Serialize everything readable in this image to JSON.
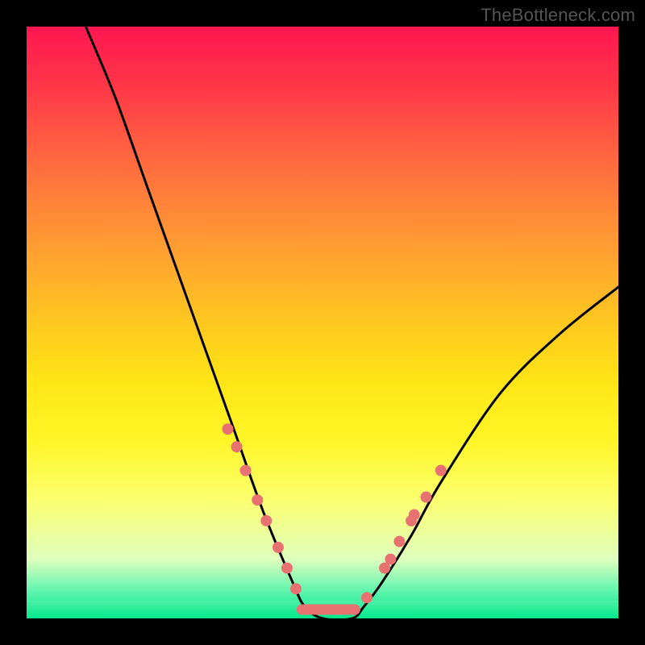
{
  "watermark": "TheBottleneck.com",
  "chart_data": {
    "type": "line",
    "title": "",
    "xlabel": "",
    "ylabel": "",
    "xlim": [
      0,
      100
    ],
    "ylim": [
      0,
      100
    ],
    "series": [
      {
        "name": "bottleneck-curve",
        "x": [
          10,
          15,
          20,
          25,
          30,
          35,
          40,
          45,
          47,
          50,
          55,
          57,
          60,
          65,
          70,
          80,
          90,
          100
        ],
        "y": [
          100,
          88,
          74,
          60,
          46,
          32,
          18,
          6,
          2,
          0,
          0,
          2,
          6,
          14,
          23,
          38,
          48,
          56
        ]
      }
    ],
    "markers_left": [
      {
        "x": 34.0,
        "y": 32.0
      },
      {
        "x": 35.5,
        "y": 29.0
      },
      {
        "x": 37.0,
        "y": 25.0
      },
      {
        "x": 39.0,
        "y": 20.0
      },
      {
        "x": 40.5,
        "y": 16.5
      },
      {
        "x": 42.5,
        "y": 12.0
      },
      {
        "x": 44.0,
        "y": 8.5
      },
      {
        "x": 45.5,
        "y": 5.0
      }
    ],
    "markers_right": [
      {
        "x": 57.5,
        "y": 3.5
      },
      {
        "x": 60.5,
        "y": 8.5
      },
      {
        "x": 61.5,
        "y": 10.0
      },
      {
        "x": 63.0,
        "y": 13.0
      },
      {
        "x": 65.0,
        "y": 16.5
      },
      {
        "x": 65.5,
        "y": 17.5
      },
      {
        "x": 67.5,
        "y": 20.5
      },
      {
        "x": 70.0,
        "y": 25.0
      }
    ],
    "flat_segment": {
      "x0": 46.5,
      "x1": 55.5,
      "y": 1.5
    },
    "colors": {
      "gradient_top": "#ff1650",
      "gradient_mid": "#ffe516",
      "gradient_bottom": "#00e78b",
      "curve": "#000000",
      "markers": "#e87272"
    }
  }
}
